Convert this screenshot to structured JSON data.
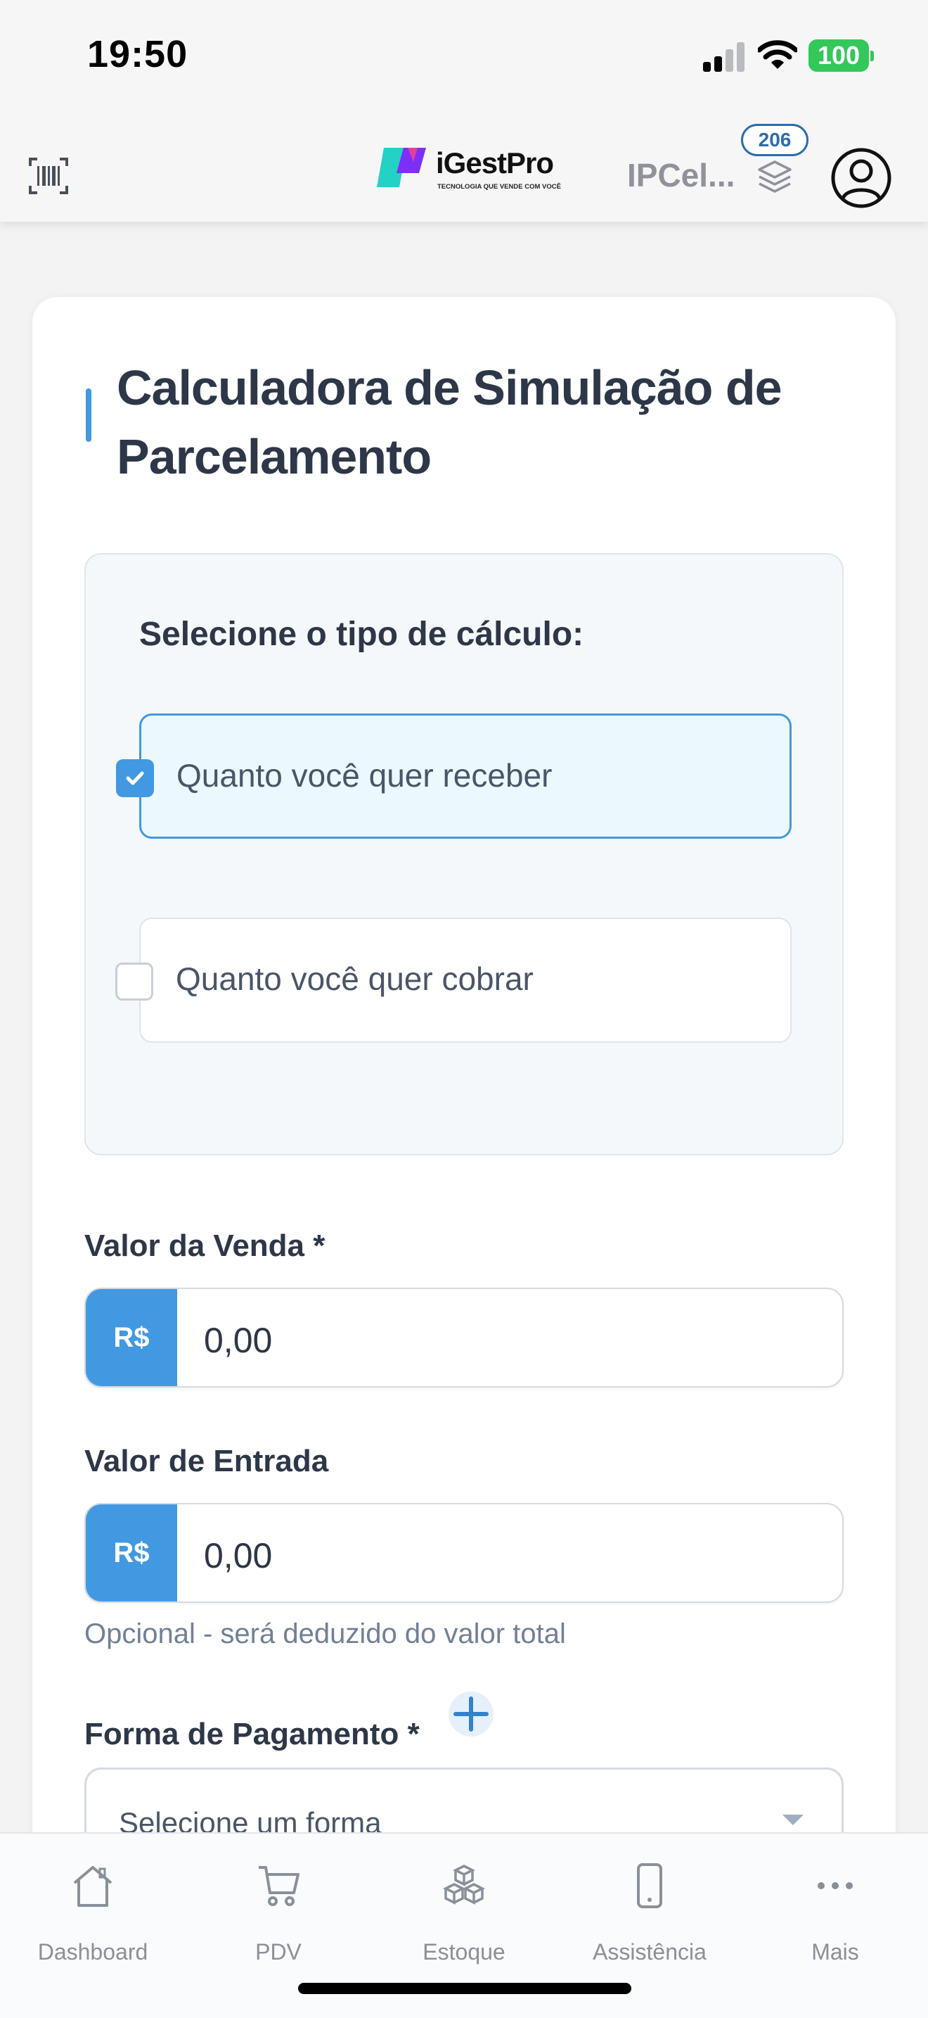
{
  "status_bar": {
    "time": "19:50",
    "battery": "100",
    "icons": [
      "signal-icon",
      "wifi-icon",
      "battery-icon"
    ]
  },
  "header": {
    "logo_text": "iGestPro",
    "logo_tagline": "TECNOLOGIA QUE VENDE COM VOCÊ",
    "company": "IPCel...",
    "badge_count": "206",
    "icons": [
      "barcode-scanner-icon",
      "layers-icon",
      "user-avatar-icon"
    ]
  },
  "calculator": {
    "title": "Calculadora de Simulação de Parcelamento",
    "type_label": "Selecione o tipo de cálculo:",
    "options": [
      {
        "label": "Quanto você quer receber",
        "checked": true
      },
      {
        "label": "Quanto você quer cobrar",
        "checked": false
      }
    ],
    "sale_value": {
      "label": "Valor da Venda *",
      "prefix": "R$",
      "value": "0,00"
    },
    "down_payment": {
      "label": "Valor de Entrada",
      "prefix": "R$",
      "value": "0,00",
      "help": "Opcional - será deduzido do valor total"
    },
    "payment_method": {
      "label": "Forma de Pagamento *",
      "placeholder": "Selecione um forma"
    }
  },
  "bottom_nav": {
    "items": [
      {
        "label": "Dashboard",
        "icon": "home-icon"
      },
      {
        "label": "PDV",
        "icon": "cart-icon"
      },
      {
        "label": "Estoque",
        "icon": "boxes-icon"
      },
      {
        "label": "Assistência",
        "icon": "phone-icon"
      },
      {
        "label": "Mais",
        "icon": "more-icon"
      }
    ]
  },
  "colors": {
    "accent": "#4299e1",
    "title": "#2d3748",
    "selected_bg": "#ebf8fe",
    "battery": "#34c759"
  }
}
